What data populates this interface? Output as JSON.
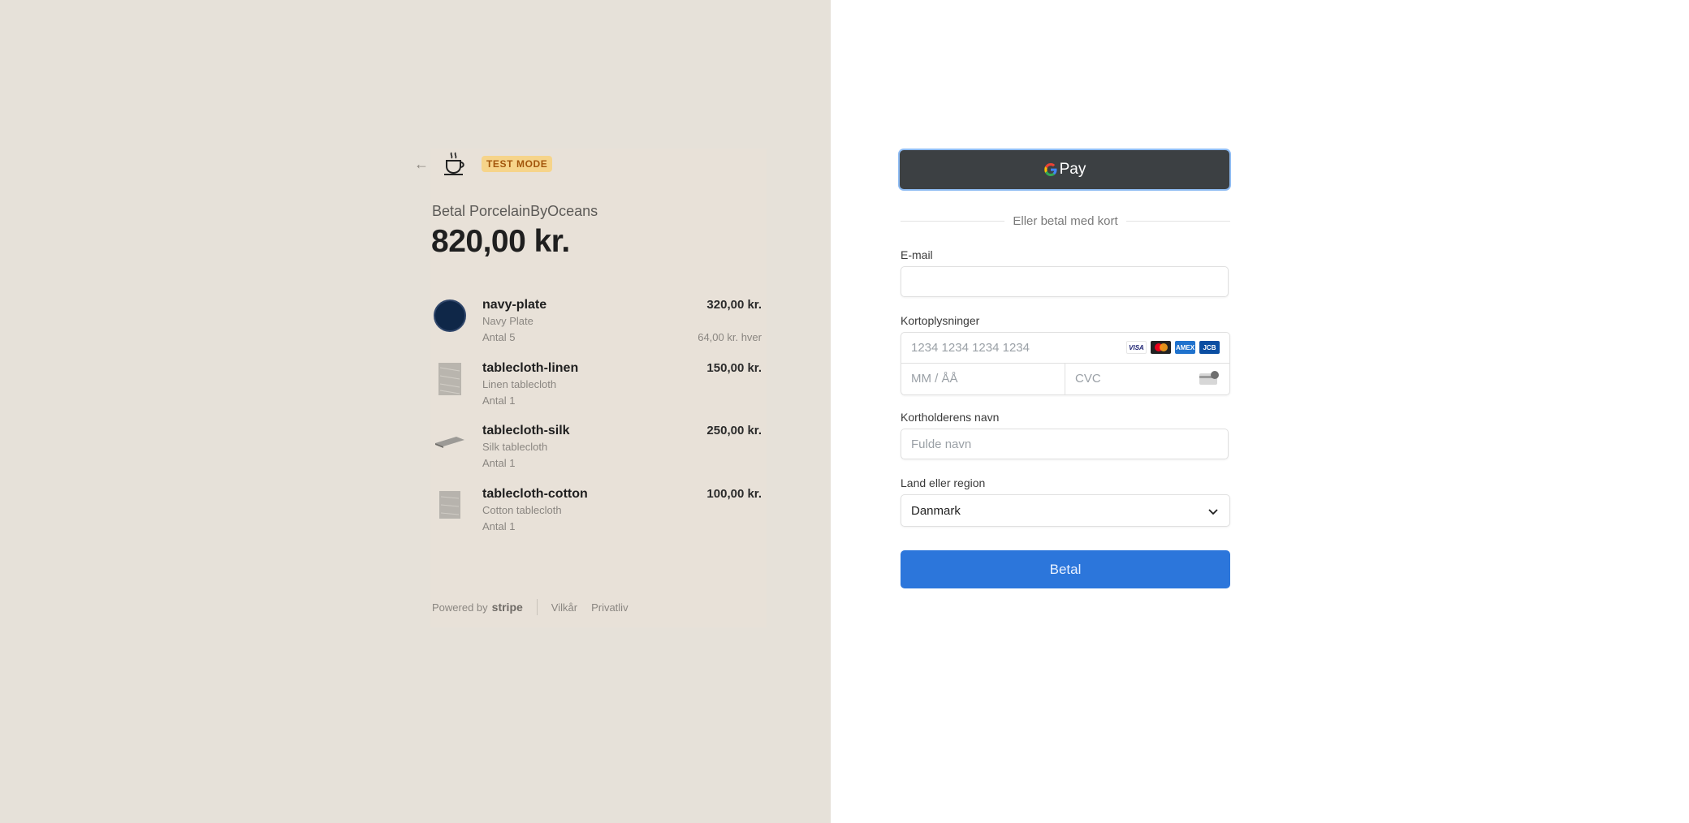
{
  "colors": {
    "left_background": "#e6e1d9",
    "test_badge_bg": "#f6d48a",
    "gpay_bg": "#3c4043",
    "pay_button_bg": "#2c76db"
  },
  "header": {
    "back_icon": "arrow-left-icon",
    "logo_icon": "coffee-cup-icon",
    "test_mode_badge": "TEST MODE"
  },
  "summary": {
    "merchant_line": "Betal PorcelainByOceans",
    "total": "820,00 kr."
  },
  "line_items": [
    {
      "name": "navy-plate",
      "description": "Navy Plate",
      "quantity": "Antal 5",
      "price": "320,00 kr.",
      "unit_price": "64,00 kr. hver",
      "thumb": "navy-plate-image"
    },
    {
      "name": "tablecloth-linen",
      "description": "Linen tablecloth",
      "quantity": "Antal 1",
      "price": "150,00 kr.",
      "unit_price": "",
      "thumb": "linen-tablecloth-image"
    },
    {
      "name": "tablecloth-silk",
      "description": "Silk tablecloth",
      "quantity": "Antal 1",
      "price": "250,00 kr.",
      "unit_price": "",
      "thumb": "silk-tablecloth-image"
    },
    {
      "name": "tablecloth-cotton",
      "description": "Cotton tablecloth",
      "quantity": "Antal 1",
      "price": "100,00 kr.",
      "unit_price": "",
      "thumb": "cotton-tablecloth-image"
    }
  ],
  "footer": {
    "powered_by": "Powered by",
    "stripe": "stripe",
    "terms": "Vilkår",
    "privacy": "Privatliv"
  },
  "payment": {
    "gpay_label": "Pay",
    "divider_text": "Eller betal med kort",
    "email_label": "E-mail",
    "email_value": "",
    "card_label": "Kortoplysninger",
    "card_number_placeholder": "1234 1234 1234 1234",
    "card_brands": [
      "VISA",
      "mastercard",
      "AMEX",
      "JCB"
    ],
    "expiry_placeholder": "MM / ÅÅ",
    "cvc_placeholder": "CVC",
    "name_label": "Kortholderens navn",
    "name_placeholder": "Fulde navn",
    "country_label": "Land eller region",
    "country_value": "Danmark",
    "pay_button": "Betal"
  }
}
